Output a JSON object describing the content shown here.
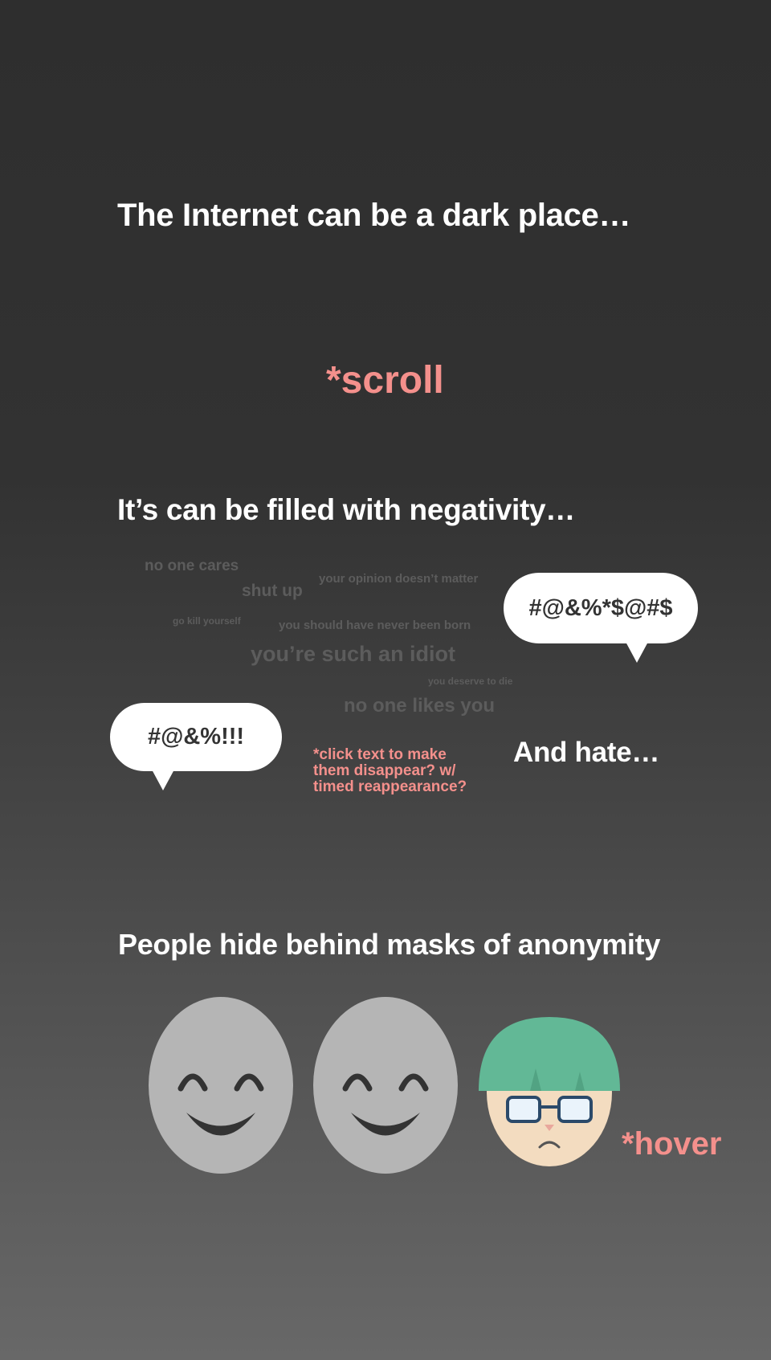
{
  "section1": {
    "heading": "The Internet can be a dark place…"
  },
  "scroll_hint": "*scroll",
  "section2": {
    "heading": "It’s can be filled with negativity…",
    "phrases": [
      "no one cares",
      "shut up",
      "your opinion doesn’t matter",
      "go kill yourself",
      "you should have never been born",
      "you’re such an idiot",
      "you deserve to die",
      "no one likes you"
    ],
    "bubble_right": "#@&%*$@#$",
    "bubble_left": "#@&%!!!",
    "click_note": [
      "*click text to make",
      "them disappear? w/",
      "timed reappearance?"
    ],
    "hate_label": "And hate…"
  },
  "section3": {
    "heading": "People hide behind masks of anonymity",
    "hover_hint": "*hover"
  },
  "colors": {
    "accent": "#f4908c",
    "mask": "#b5b5b5",
    "hair": "#62b896",
    "skin": "#f3dcc0",
    "glasses": "#2b4a6a"
  },
  "icons": [
    "smiling-mask-icon",
    "smiling-mask-icon",
    "sad-person-icon"
  ]
}
